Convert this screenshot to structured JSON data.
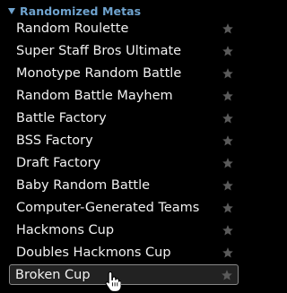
{
  "section": {
    "title": "Randomized Metas",
    "caret_icon": "caret-down-icon"
  },
  "formats": [
    {
      "label": "Random Roulette"
    },
    {
      "label": "Super Staff Bros Ultimate"
    },
    {
      "label": "Monotype Random Battle"
    },
    {
      "label": "Random Battle Mayhem"
    },
    {
      "label": "Battle Factory"
    },
    {
      "label": "BSS Factory"
    },
    {
      "label": "Draft Factory"
    },
    {
      "label": "Baby Random Battle"
    },
    {
      "label": "Computer-Generated Teams"
    },
    {
      "label": "Hackmons Cup"
    },
    {
      "label": "Doubles Hackmons Cup"
    },
    {
      "label": "Broken Cup"
    }
  ],
  "hovered_index": 11,
  "icons": {
    "favorite": "star-icon",
    "pointer": "hand-pointer-icon"
  },
  "colors": {
    "background": "#000000",
    "header_text": "#6fa3cf",
    "item_text": "#f1f1f1",
    "star": "#5a5a5a",
    "hover_bg": "#222222",
    "hover_border": "#888888"
  }
}
